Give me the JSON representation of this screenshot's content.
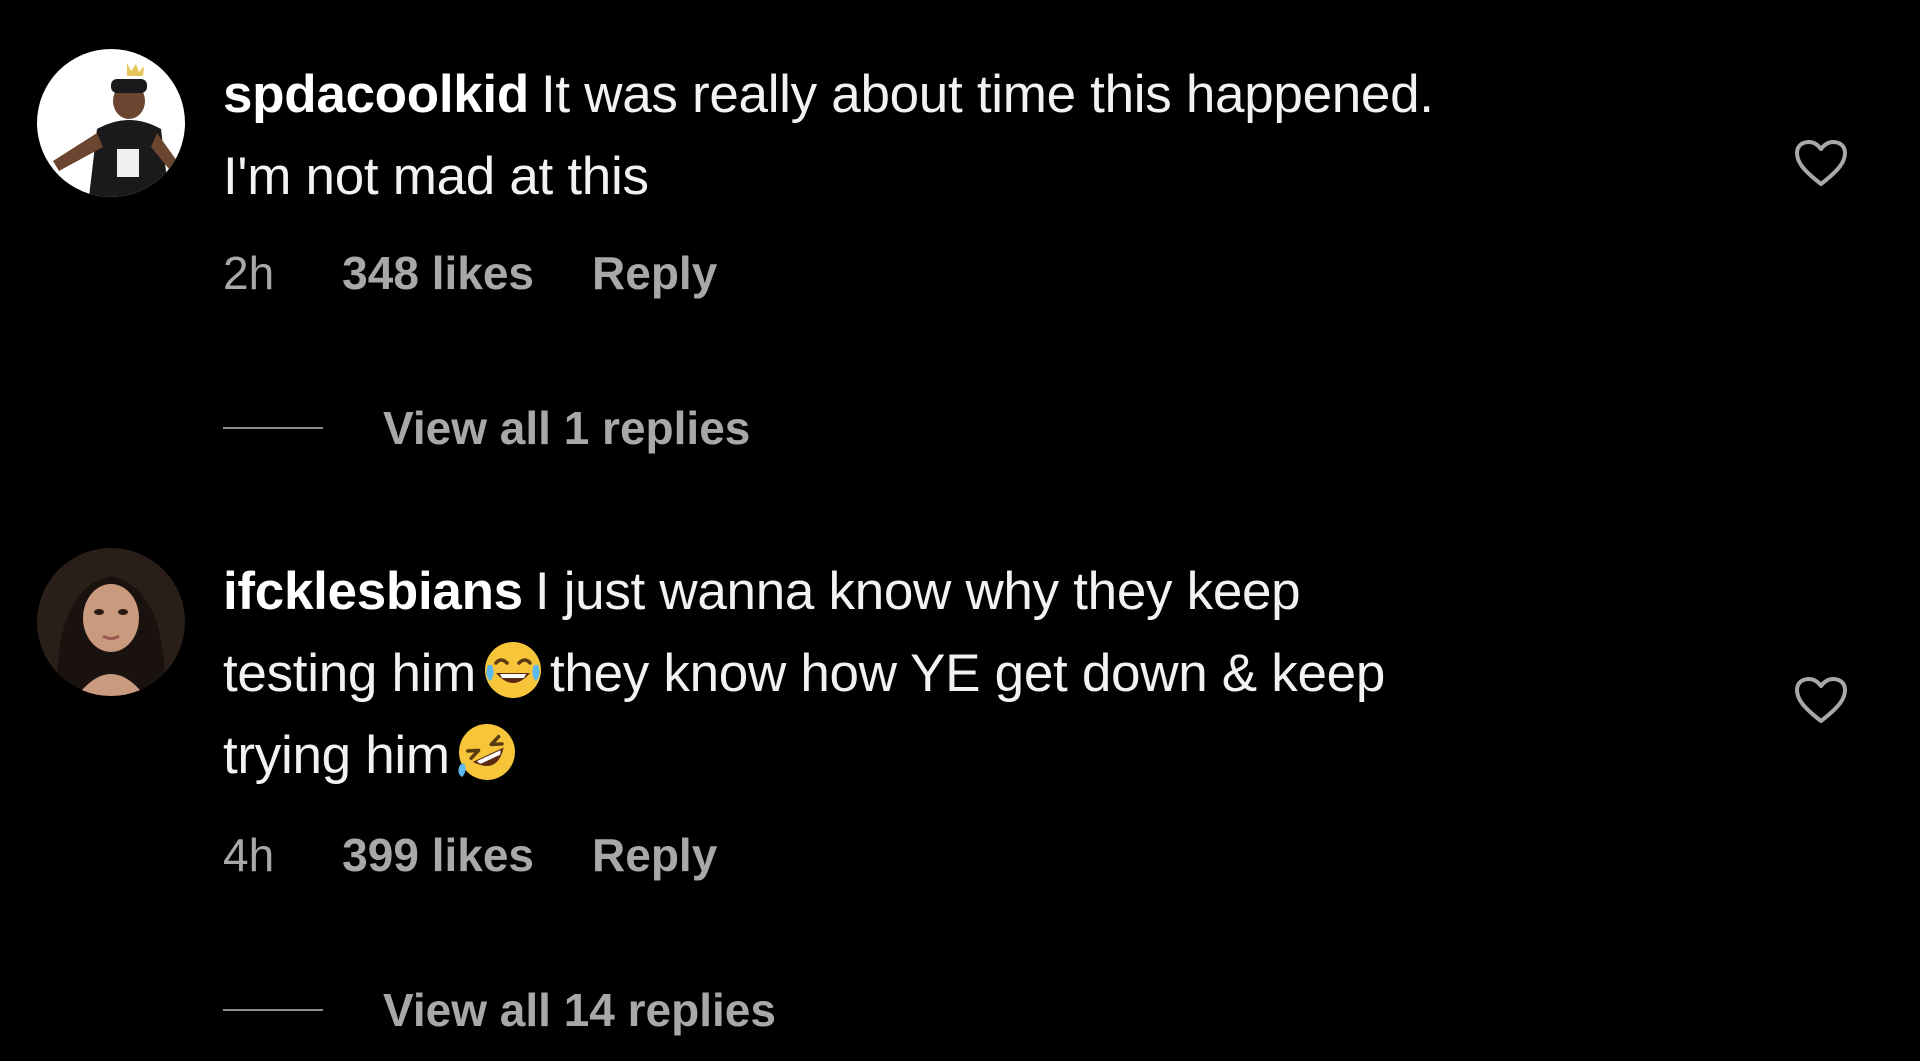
{
  "comments": [
    {
      "username": "spdacoolkid",
      "text_lines": [
        "It was really about time this happened.",
        "I'm not mad at this"
      ],
      "time": "2h",
      "likes": "348 likes",
      "reply_label": "Reply",
      "view_replies": "View all 1 replies"
    },
    {
      "username": "ifcklesbians",
      "text_part1": "I just wanna know why they keep",
      "text_part2": "testing him",
      "emoji1": "face-with-tears-of-joy",
      "text_part3": "they know how YE get down & keep",
      "text_part4": "trying him",
      "emoji2": "rolling-on-the-floor-laughing",
      "time": "4h",
      "likes": "399 likes",
      "reply_label": "Reply",
      "view_replies": "View all 14 replies"
    }
  ],
  "colors": {
    "background": "#000000",
    "primary_text": "#f2f2f2",
    "secondary_text": "#a8a8a8"
  }
}
